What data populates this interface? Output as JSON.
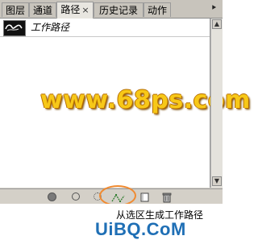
{
  "tabs": [
    {
      "label": "图层"
    },
    {
      "label": "通道"
    },
    {
      "label": "路径",
      "active": true,
      "close": "×"
    },
    {
      "label": "历史记录"
    },
    {
      "label": "动作"
    }
  ],
  "panel_menu_glyph": "⯈",
  "paths": [
    {
      "name": "工作路径"
    }
  ],
  "watermark": "www.68ps.com",
  "toolbar": {
    "fill_path_icon": "fill-path-icon",
    "stroke_path_icon": "stroke-path-icon",
    "load_selection_icon": "load-path-as-selection-icon",
    "make_work_path_icon": "make-work-path-icon",
    "new_path_icon": "new-path-icon",
    "delete_path_icon": "trash-icon"
  },
  "scroll": {
    "up": "▲",
    "down": "▼"
  },
  "lower_text": "从选区生成工作路径",
  "brand": "UiBQ.CoM",
  "brand_url": "www.sar",
  "colors": {
    "highlight": "#f08a30",
    "watermark": "#f7c818"
  }
}
